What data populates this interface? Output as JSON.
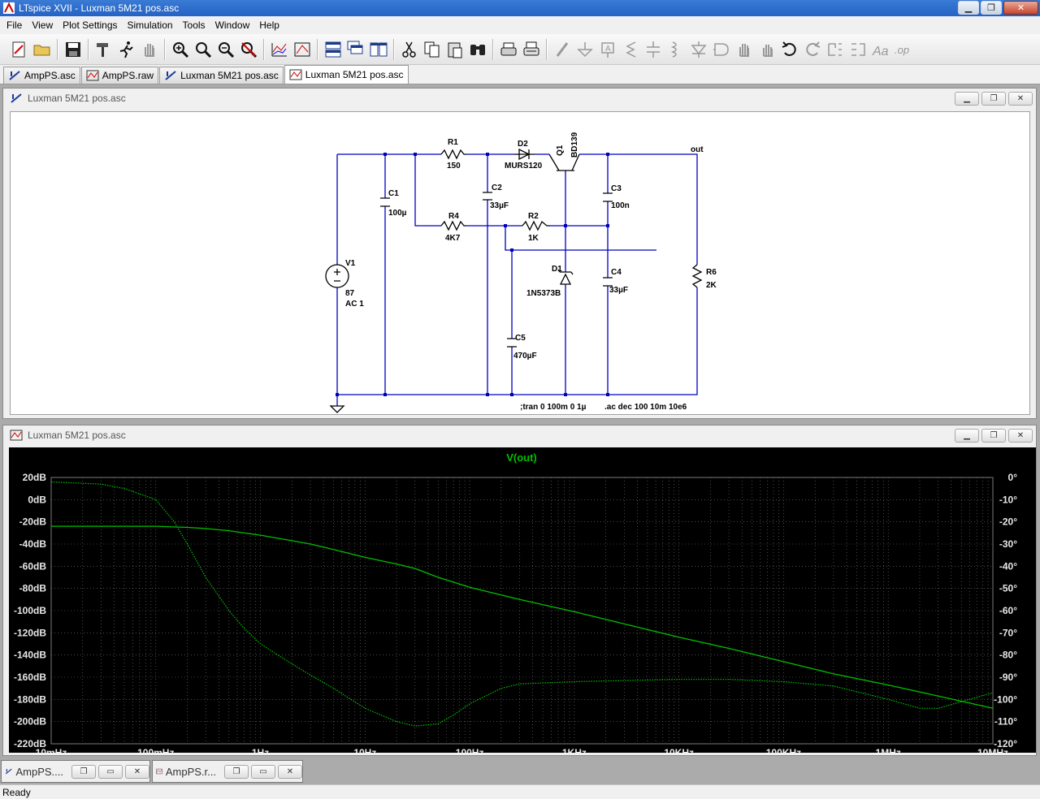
{
  "window": {
    "title": "LTspice XVII - Luxman 5M21 pos.asc",
    "controls": [
      "minimize",
      "restore",
      "close"
    ]
  },
  "menu": [
    "File",
    "View",
    "Plot Settings",
    "Simulation",
    "Tools",
    "Window",
    "Help"
  ],
  "toolbar": {
    "icons": [
      "new-schematic-icon",
      "open-folder-icon",
      "save-icon",
      "hammer-icon",
      "run-icon",
      "halt-hand-icon",
      "zoom-in-icon",
      "zoom-fit-icon",
      "zoom-out-icon",
      "zoom-cancel-icon",
      "autorange-icon",
      "pick-visible-traces-icon",
      "tile-horizontal-icon",
      "cascade-icon",
      "tile-vertical-icon",
      "cut-icon",
      "copy-icon",
      "paste-icon",
      "find-icon",
      "print-preview-icon",
      "print-icon",
      "wire-icon",
      "ground-icon",
      "label-icon",
      "resistor-icon",
      "capacitor-icon",
      "inductor-icon",
      "diode-icon",
      "component-icon",
      "move-icon",
      "drag-icon",
      "undo-icon",
      "redo-icon",
      "rotate-icon",
      "mirror-icon",
      "text-icon",
      "spice-directive-icon"
    ]
  },
  "tabs": [
    {
      "label": "AmpPS.asc",
      "icon": "schematic-icon",
      "active": false
    },
    {
      "label": "AmpPS.raw",
      "icon": "waveform-icon",
      "active": false
    },
    {
      "label": "Luxman 5M21 pos.asc",
      "icon": "schematic-icon",
      "active": false
    },
    {
      "label": "Luxman 5M21 pos.asc",
      "icon": "waveform-icon",
      "active": true
    }
  ],
  "schematic_window": {
    "title": "Luxman 5M21 pos.asc",
    "components": {
      "r1_name": "R1",
      "r1_value": "150",
      "d2_name": "D2",
      "d2_value": "MURS120",
      "q1_name": "Q1",
      "q1_value": "BD139",
      "out_label": "out",
      "c1_name": "C1",
      "c1_value": "100µ",
      "c2_name": "C2",
      "c2_value": "33µF",
      "c3_name": "C3",
      "c3_value": "100n",
      "r4_name": "R4",
      "r4_value": "4K7",
      "r2_name": "R2",
      "r2_value": "1K",
      "v1_name": "V1",
      "v1_value": "87",
      "v1_ac": "AC 1",
      "d1_name": "D1",
      "d1_value": "1N5373B",
      "c4_name": "C4",
      "c4_value": "33µF",
      "r6_name": "R6",
      "r6_value": "2K",
      "c5_name": "C5",
      "c5_value": "470µF"
    },
    "directives": {
      "tran": ";tran 0 100m 0 1µ",
      "ac": ".ac dec 100 10m 10e6"
    }
  },
  "plot_window": {
    "title": "Luxman 5M21 pos.asc",
    "colors": {
      "background": "#000000",
      "trace": "#00c000",
      "grid": "#7a7a7a",
      "axis_text": "#e8e8e8"
    }
  },
  "chart_data": {
    "type": "line",
    "title": "V(out)",
    "x_scale": "log",
    "x_ticks": [
      "10mHz",
      "100mHz",
      "1Hz",
      "10Hz",
      "100Hz",
      "1KHz",
      "10KHz",
      "100KHz",
      "1MHz",
      "10MHz"
    ],
    "xlim": [
      0.01,
      10000000
    ],
    "y_left_ticks": [
      "20dB",
      "0dB",
      "-20dB",
      "-40dB",
      "-60dB",
      "-80dB",
      "-100dB",
      "-120dB",
      "-140dB",
      "-160dB",
      "-180dB",
      "-200dB",
      "-220dB"
    ],
    "y_left_lim": [
      -220,
      20
    ],
    "y_right_ticks": [
      "0°",
      "-10°",
      "-20°",
      "-30°",
      "-40°",
      "-50°",
      "-60°",
      "-70°",
      "-80°",
      "-90°",
      "-100°",
      "-110°",
      "-120°"
    ],
    "y_right_lim": [
      -120,
      0
    ],
    "grid": true,
    "series": [
      {
        "name": "V(out)",
        "axis": "left",
        "style": "solid",
        "x": [
          0.01,
          0.03,
          0.1,
          0.2,
          0.3,
          0.5,
          1,
          2,
          3,
          5,
          10,
          20,
          30,
          50,
          100,
          300,
          1000,
          3000,
          10000,
          30000,
          100000,
          300000,
          1000000,
          3000000,
          10000000
        ],
        "y": [
          -24,
          -24,
          -24,
          -25,
          -26,
          -28,
          -32,
          -37,
          -40,
          -45,
          -52,
          -58,
          -62,
          -70,
          -79,
          -90,
          -101,
          -112,
          -124,
          -134,
          -146,
          -157,
          -167,
          -177,
          -188
        ]
      },
      {
        "axis": "right",
        "style": "dotted",
        "x": [
          0.01,
          0.03,
          0.05,
          0.1,
          0.15,
          0.2,
          0.3,
          0.5,
          0.7,
          1,
          2,
          3,
          5,
          10,
          20,
          30,
          50,
          70,
          100,
          200,
          300,
          1000,
          3000,
          10000,
          30000,
          100000,
          300000,
          1000000,
          2000000,
          3000000,
          5000000,
          10000000
        ],
        "y": [
          -2,
          -3,
          -5,
          -10,
          -20,
          -30,
          -45,
          -60,
          -68,
          -75,
          -84,
          -89,
          -95,
          -104,
          -110,
          -112,
          -111,
          -107,
          -102,
          -95,
          -93,
          -92,
          -91.5,
          -91,
          -91,
          -92,
          -94,
          -100,
          -104,
          -104,
          -101,
          -97
        ]
      }
    ]
  },
  "minimized": [
    {
      "label": "AmpPS....",
      "icon": "schematic-icon"
    },
    {
      "label": "AmpPS.r...",
      "icon": "waveform-icon"
    }
  ],
  "status": "Ready"
}
